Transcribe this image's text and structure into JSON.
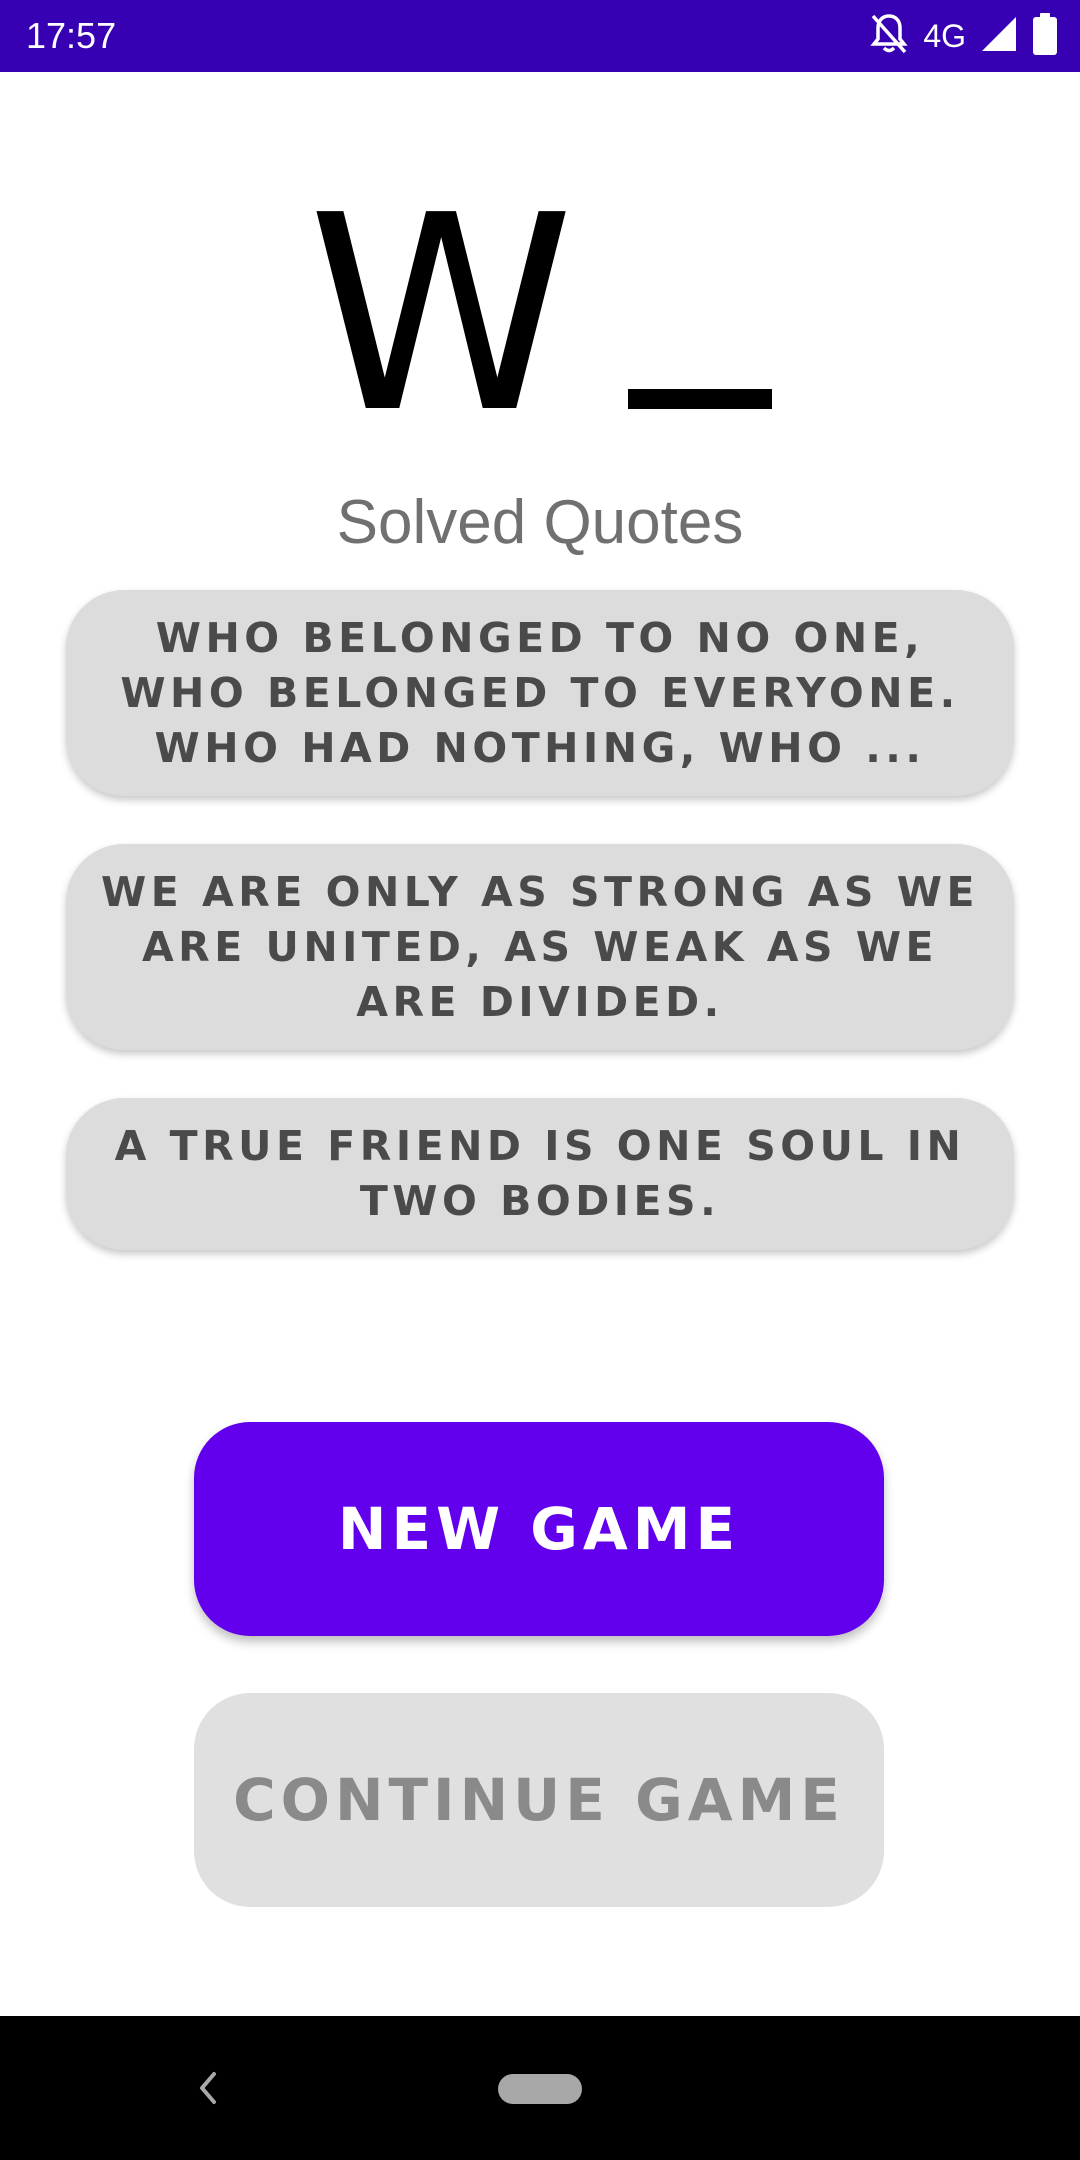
{
  "status_bar": {
    "time": "17:57",
    "network": "4G",
    "icons": [
      "notifications-off-icon",
      "signal-icon",
      "battery-icon"
    ],
    "background": "#3700b3"
  },
  "logo": {
    "letter": "W"
  },
  "solved_title": "Solved Quotes",
  "quotes": [
    "WHO BELONGED TO NO ONE, WHO BELONGED TO EVERYONE. WHO HAD NOTHING, WHO ...",
    "WE ARE ONLY AS STRONG AS WE ARE UNITED, AS WEAK AS WE ARE DIVIDED.",
    "A TRUE FRIEND IS ONE SOUL IN TWO BODIES."
  ],
  "buttons": {
    "new_game": "NEW GAME",
    "continue_game": "CONTINUE GAME"
  },
  "nav_bar": {
    "icons": [
      "back-icon",
      "home-pill-icon"
    ]
  },
  "colors": {
    "primary": "#6200ee",
    "status_bar": "#3700b3",
    "card_background": "#dcdcdc",
    "disabled_button": "#e0e0e0"
  }
}
